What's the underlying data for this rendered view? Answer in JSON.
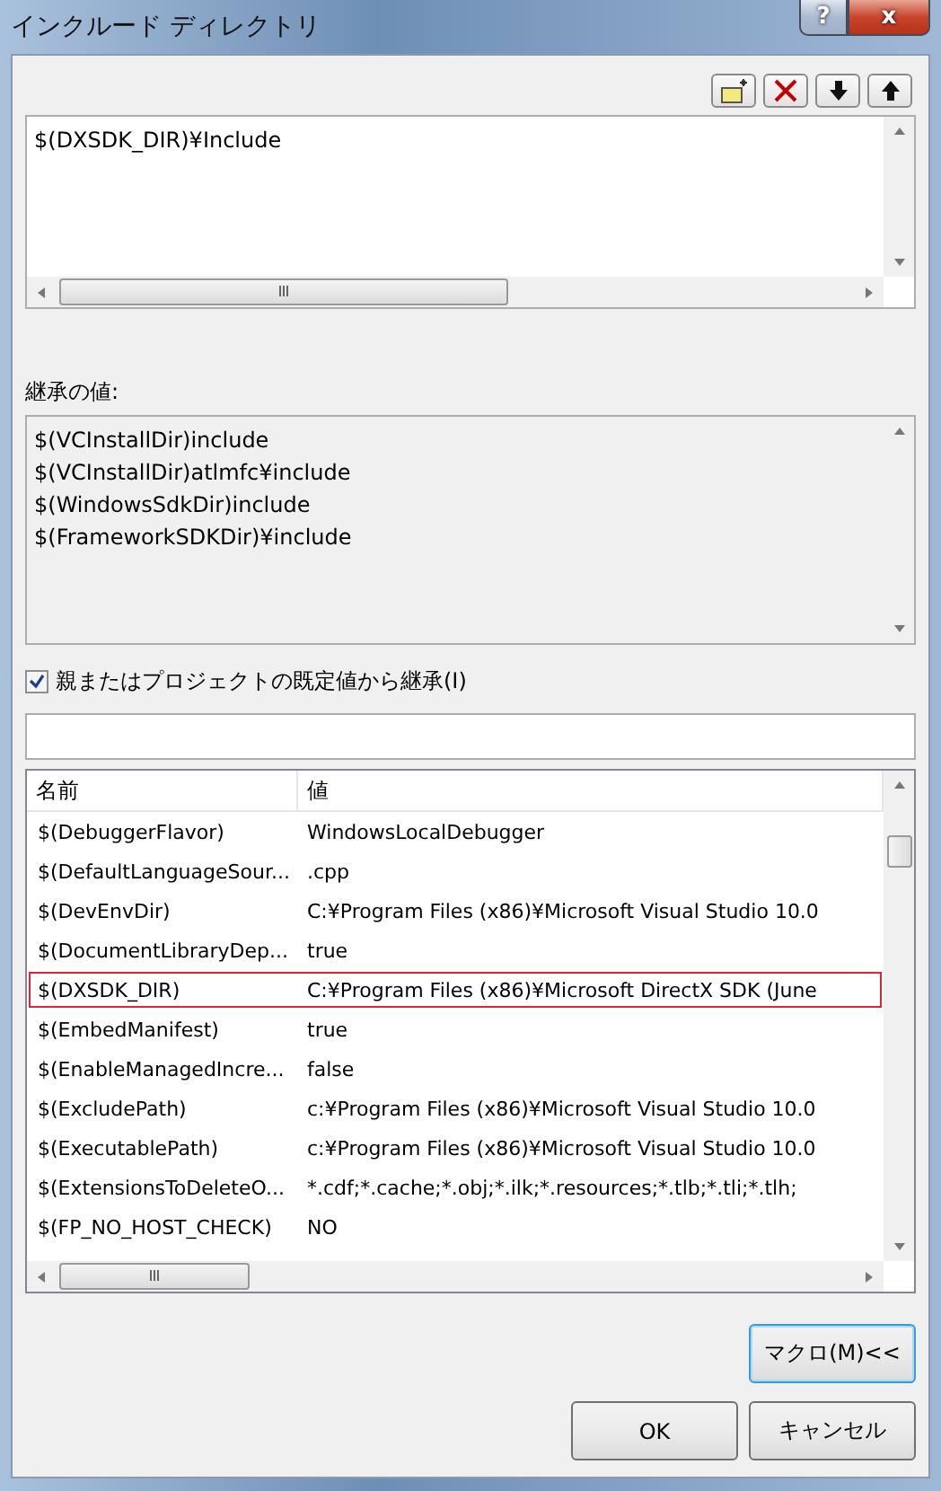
{
  "window": {
    "title": "インクルード ディレクトリ",
    "help_button": "?",
    "close_button": "x"
  },
  "toolbar": [
    {
      "kind": "new-folder"
    },
    {
      "kind": "delete"
    },
    {
      "kind": "down"
    },
    {
      "kind": "up"
    }
  ],
  "editor": {
    "lines": [
      "$(DXSDK_DIR)¥Include"
    ]
  },
  "inherited": {
    "label": "継承の値:",
    "lines": [
      "$(VCInstallDir)include",
      "$(VCInstallDir)atlmfc¥include",
      "$(WindowsSdkDir)include",
      "$(FrameworkSDKDir)¥include"
    ]
  },
  "inherit_checkbox": {
    "label": "親またはプロジェクトの既定値から継承(I)",
    "checked": true
  },
  "table": {
    "columns": [
      "名前",
      "値"
    ],
    "rows": [
      {
        "name": "$(DebuggerFlavor)",
        "value": "WindowsLocalDebugger",
        "selected": false
      },
      {
        "name": "$(DefaultLanguageSour...",
        "value": ".cpp",
        "selected": false
      },
      {
        "name": "$(DevEnvDir)",
        "value": "C:¥Program Files (x86)¥Microsoft Visual Studio 10.0",
        "selected": false
      },
      {
        "name": "$(DocumentLibraryDep...",
        "value": "true",
        "selected": false
      },
      {
        "name": "$(DXSDK_DIR)",
        "value": "C:¥Program Files (x86)¥Microsoft DirectX SDK (June",
        "selected": true
      },
      {
        "name": "$(EmbedManifest)",
        "value": "true",
        "selected": false
      },
      {
        "name": "$(EnableManagedIncre...",
        "value": "false",
        "selected": false
      },
      {
        "name": "$(ExcludePath)",
        "value": "c:¥Program Files (x86)¥Microsoft Visual Studio 10.0",
        "selected": false
      },
      {
        "name": "$(ExecutablePath)",
        "value": "c:¥Program Files (x86)¥Microsoft Visual Studio 10.0",
        "selected": false
      },
      {
        "name": "$(ExtensionsToDeleteO...",
        "value": "*.cdf;*.cache;*.obj;*.ilk;*.resources;*.tlb;*.tli;*.tlh;",
        "selected": false
      },
      {
        "name": "$(FP_NO_HOST_CHECK)",
        "value": "NO",
        "selected": false
      }
    ]
  },
  "buttons": {
    "macro": "マクロ(M)<<",
    "ok": "OK",
    "cancel": "キャンセル"
  }
}
